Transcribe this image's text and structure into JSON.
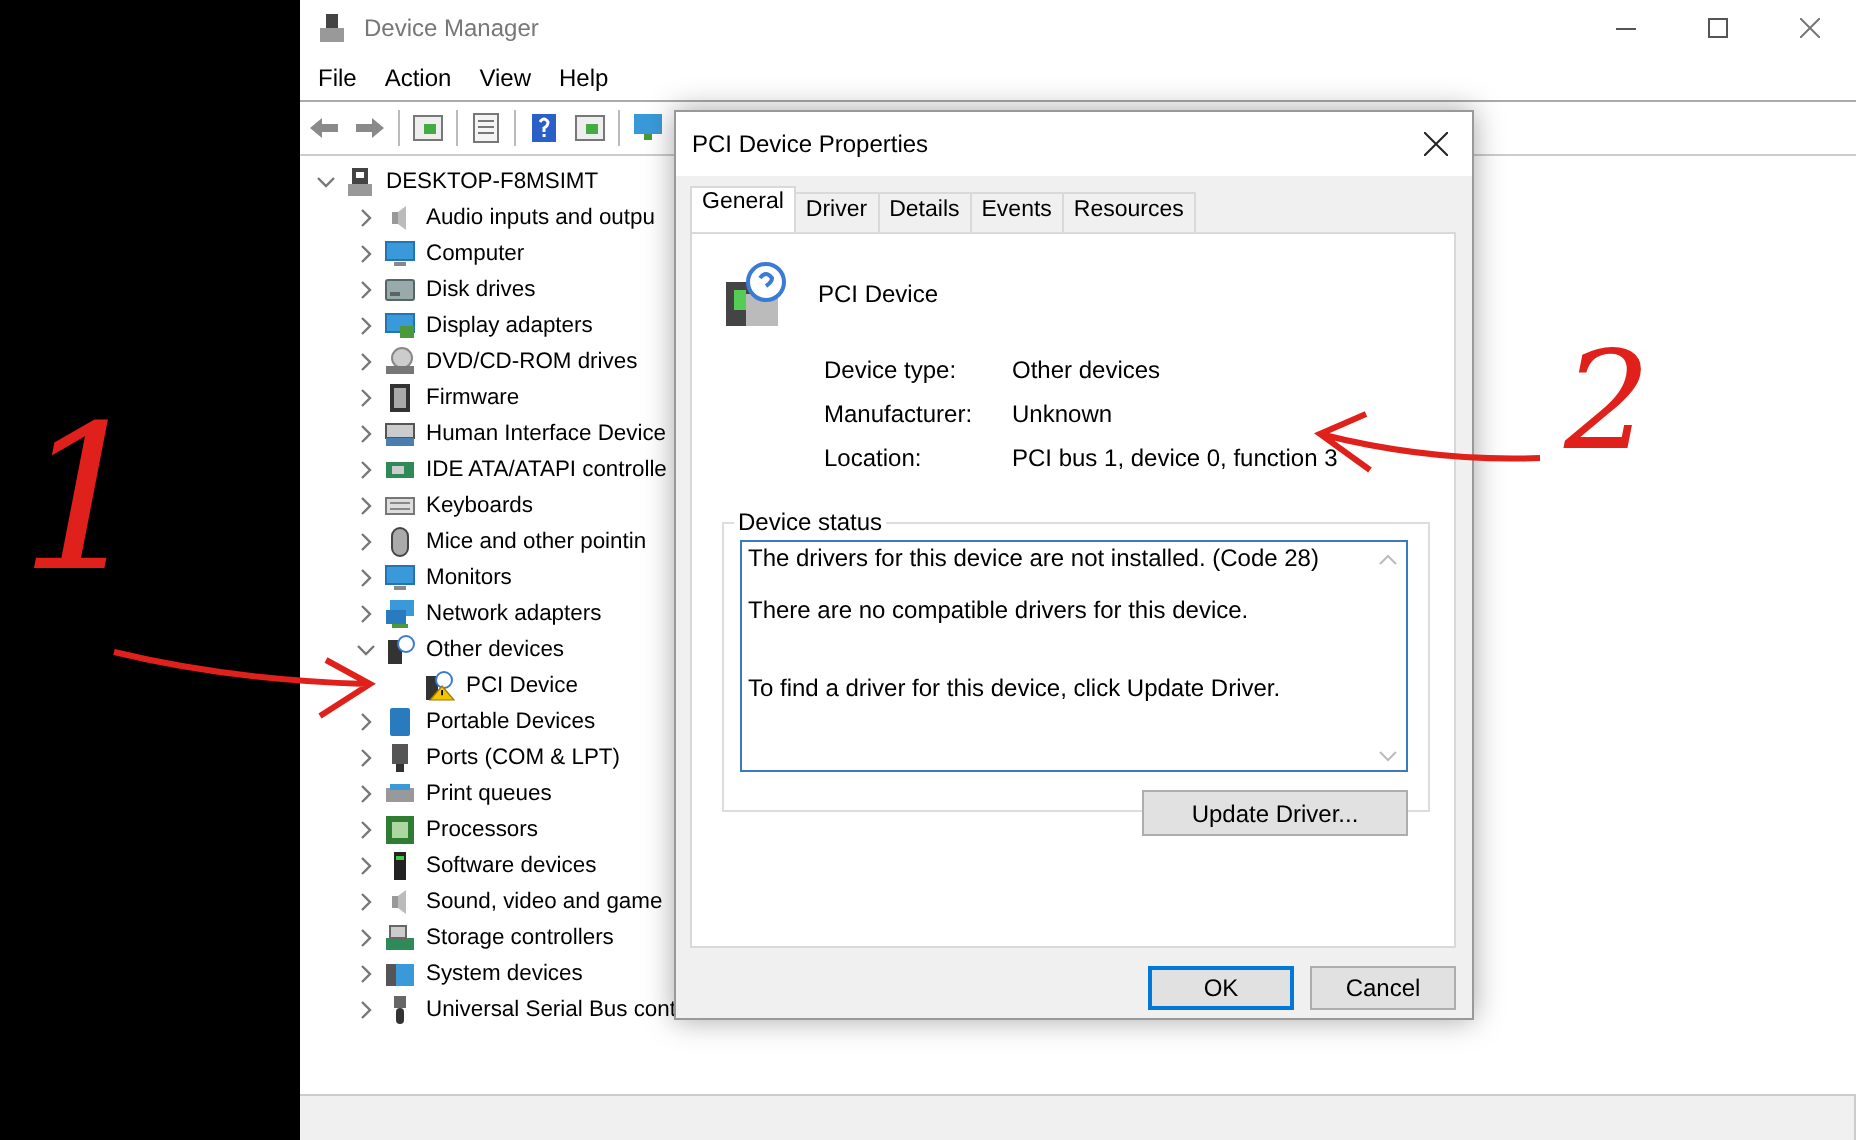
{
  "window": {
    "title": "Device Manager"
  },
  "menu": [
    {
      "label": "File"
    },
    {
      "label": "Action"
    },
    {
      "label": "View"
    },
    {
      "label": "Help"
    }
  ],
  "tree": {
    "label": "DESKTOP-F8MSIMT",
    "expanded": true,
    "children": [
      {
        "label": "Audio inputs and outpu",
        "expanded": false
      },
      {
        "label": "Computer",
        "expanded": false
      },
      {
        "label": "Disk drives",
        "expanded": false
      },
      {
        "label": "Display adapters",
        "expanded": false
      },
      {
        "label": "DVD/CD-ROM drives",
        "expanded": false
      },
      {
        "label": "Firmware",
        "expanded": false
      },
      {
        "label": "Human Interface Device",
        "expanded": false
      },
      {
        "label": "IDE ATA/ATAPI controlle",
        "expanded": false
      },
      {
        "label": "Keyboards",
        "expanded": false
      },
      {
        "label": "Mice and other pointin",
        "expanded": false
      },
      {
        "label": "Monitors",
        "expanded": false
      },
      {
        "label": "Network adapters",
        "expanded": false
      },
      {
        "label": "Other devices",
        "expanded": true,
        "children": [
          {
            "label": "PCI Device",
            "warning": true
          }
        ]
      },
      {
        "label": "Portable Devices",
        "expanded": false
      },
      {
        "label": "Ports (COM & LPT)",
        "expanded": false
      },
      {
        "label": "Print queues",
        "expanded": false
      },
      {
        "label": "Processors",
        "expanded": false
      },
      {
        "label": "Software devices",
        "expanded": false
      },
      {
        "label": "Sound, video and game",
        "expanded": false
      },
      {
        "label": "Storage controllers",
        "expanded": false
      },
      {
        "label": "System devices",
        "expanded": false
      },
      {
        "label": "Universal Serial Bus cont",
        "expanded": false
      }
    ]
  },
  "dialog": {
    "title": "PCI Device Properties",
    "tabs": [
      {
        "label": "General",
        "selected": true
      },
      {
        "label": "Driver",
        "selected": false
      },
      {
        "label": "Details",
        "selected": false
      },
      {
        "label": "Events",
        "selected": false
      },
      {
        "label": "Resources",
        "selected": false
      }
    ],
    "device_name": "PCI Device",
    "properties": [
      {
        "label": "Device type:",
        "value": "Other devices"
      },
      {
        "label": "Manufacturer:",
        "value": "Unknown"
      },
      {
        "label": "Location:",
        "value": "PCI bus 1, device 0, function 3"
      }
    ],
    "status": {
      "legend": "Device status",
      "message": "The drivers for this device are not installed. (Code 28)\n\nThere are no compatible drivers for this device.\n\n\nTo find a driver for this device, click Update Driver."
    },
    "update_button": "Update Driver...",
    "buttons": [
      {
        "label": "OK",
        "default": true
      },
      {
        "label": "Cancel",
        "default": false
      }
    ]
  },
  "annotations": [
    {
      "label": "1"
    },
    {
      "label": "2"
    }
  ]
}
